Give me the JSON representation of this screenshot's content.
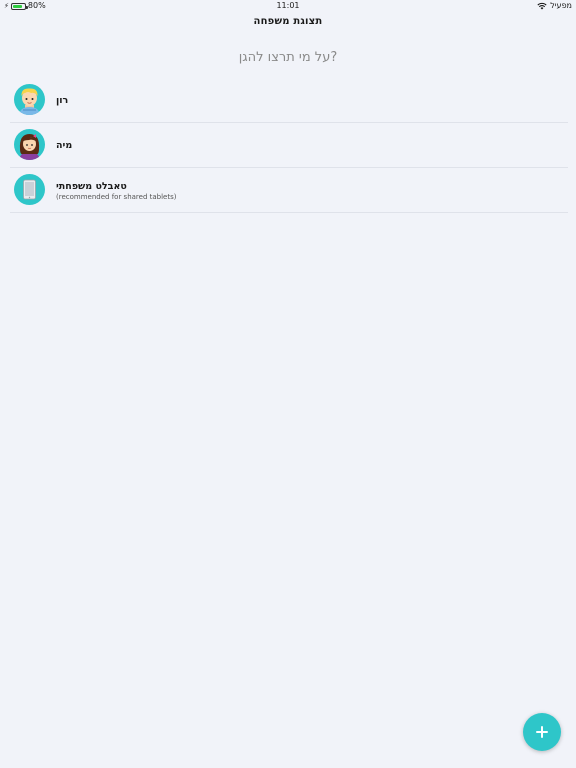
{
  "status_bar": {
    "battery_percent": "80%",
    "battery_level": 0.8,
    "time": "11:01",
    "carrier": "מפעיל"
  },
  "header": {
    "title": "תצוגת משפחה"
  },
  "question": "על מי תרצו להגן?",
  "profiles": [
    {
      "name": "רון",
      "avatar_icon": "boy-avatar-icon",
      "subtitle": ""
    },
    {
      "name": "מיה",
      "avatar_icon": "girl-avatar-icon",
      "subtitle": ""
    },
    {
      "name": "טאבלט משפחתי",
      "avatar_icon": "tablet-avatar-icon",
      "subtitle": "(recommended for shared tablets)"
    }
  ],
  "fab": {
    "icon": "plus-icon"
  },
  "colors": {
    "accent": "#2ec6c9",
    "background": "#f1f3f9",
    "battery": "#2ecc40"
  }
}
